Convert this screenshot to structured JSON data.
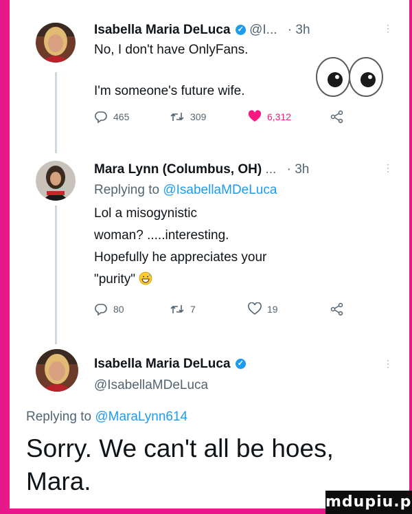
{
  "tweets": [
    {
      "author": "Isabella Maria DeLuca",
      "verified": true,
      "handle_trunc": "@I...",
      "time": "· 3h",
      "lines": [
        "No, I don't have OnlyFans.",
        "I'm someone's future wife."
      ],
      "emoji": "eyes",
      "stats": {
        "replies": "465",
        "retweets": "309",
        "likes": "6,312"
      },
      "liked": true
    },
    {
      "author": "Mara Lynn (Columbus, OH)",
      "ellipsis": "...",
      "time": "· 3h",
      "replying_prefix": "Replying to",
      "replying_handle": "@IsabellaMDeLuca",
      "lines": [
        "Lol a misogynistic",
        "woman? .....interesting.",
        "Hopefully he appreciates your",
        "\"purity\""
      ],
      "emoji": "grinning-sweat",
      "stats": {
        "replies": "80",
        "retweets": "7",
        "likes": "19"
      }
    },
    {
      "author": "Isabella Maria DeLuca",
      "verified": true,
      "handle": "@IsabellaMDeLuca",
      "replying_prefix": "Replying to",
      "replying_handle": "@MaraLynn614",
      "big_lines": [
        "Sorry. We can't all be hoes,",
        "Mara."
      ]
    }
  ],
  "watermark": "mdupiu.pl",
  "colors": {
    "brand": "#1d9bf0",
    "like": "#f91880",
    "frame": "#e8178a"
  },
  "icons": [
    "verified-badge-icon",
    "reply-icon",
    "retweet-icon",
    "heart-icon",
    "share-icon",
    "more-dots-icon",
    "eyes-emoji-icon",
    "grinning-sweat-emoji-icon"
  ]
}
